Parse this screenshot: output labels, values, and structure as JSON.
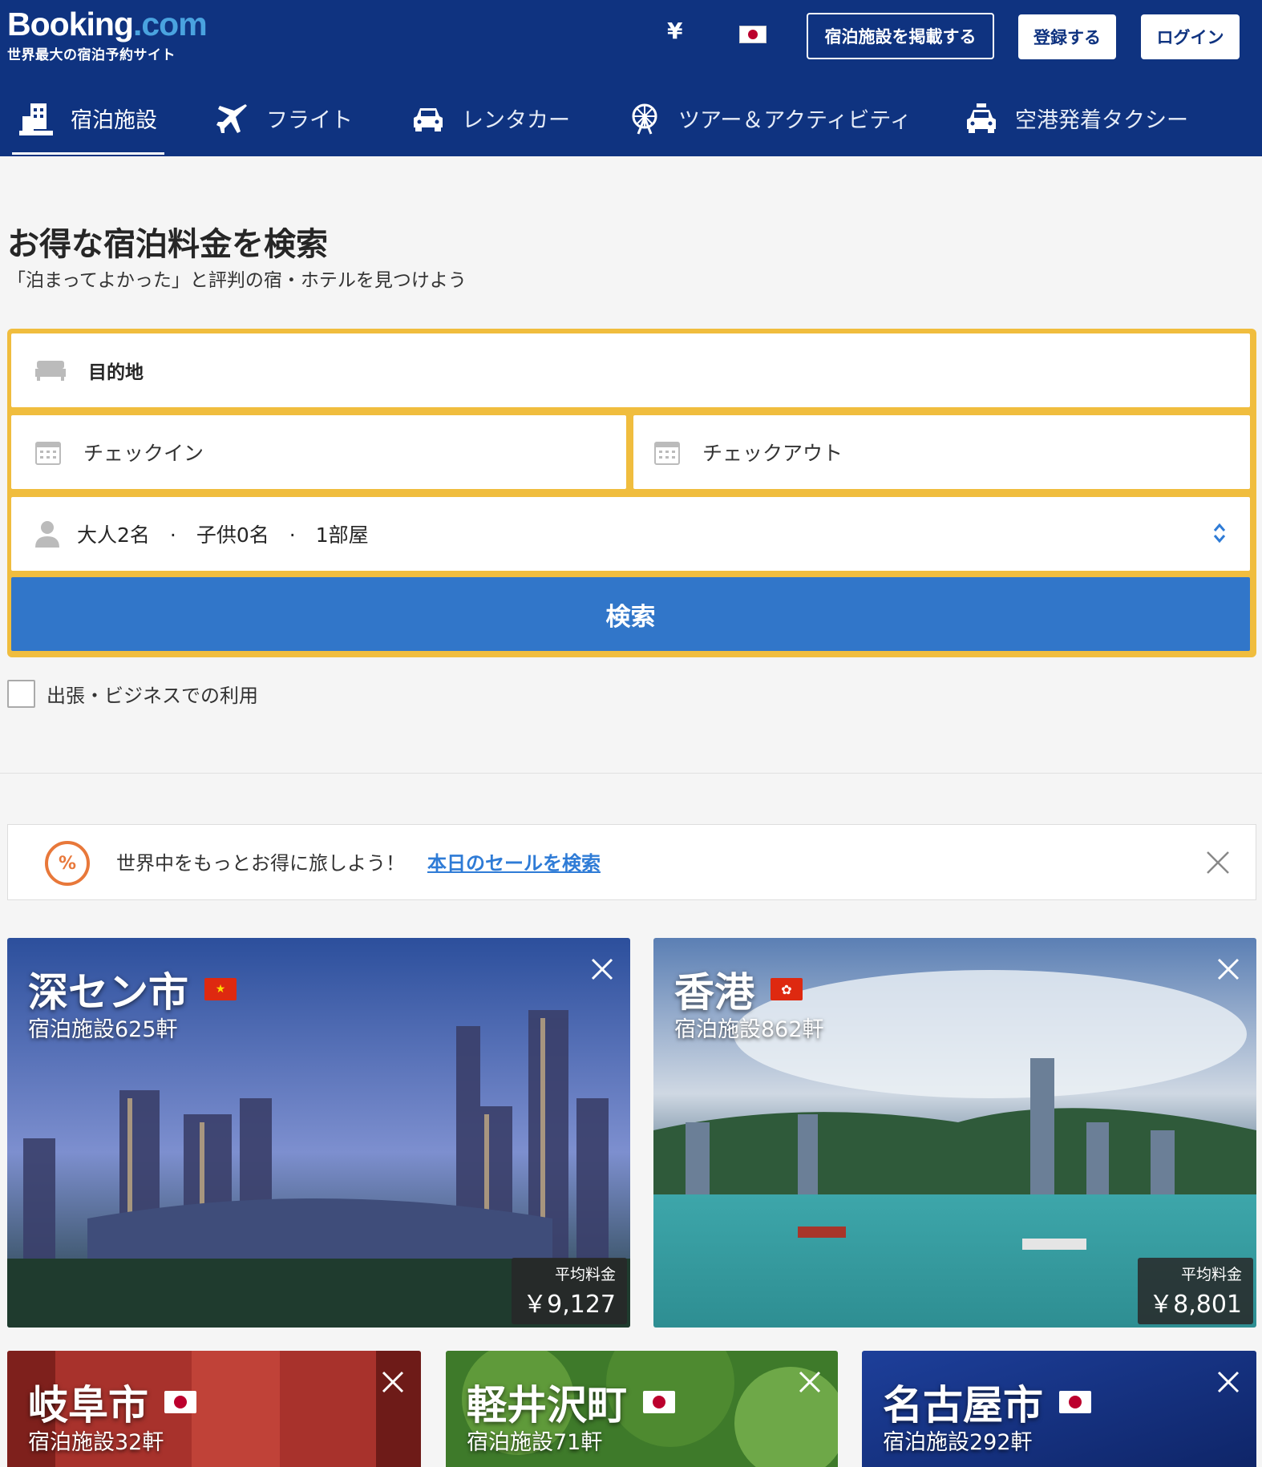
{
  "header": {
    "logo_main": "Booking",
    "logo_dotcom": ".com",
    "logo_tagline": "世界最大の宿泊予約サイト",
    "currency": "¥",
    "list_property": "宿泊施設を掲載する",
    "register": "登録する",
    "login": "ログイン"
  },
  "nav": {
    "items": [
      {
        "label": "宿泊施設",
        "icon": "bed-building-icon",
        "active": true
      },
      {
        "label": "フライト",
        "icon": "plane-icon"
      },
      {
        "label": "レンタカー",
        "icon": "car-icon"
      },
      {
        "label": "ツアー＆アクティビティ",
        "icon": "ferris-wheel-icon"
      },
      {
        "label": "空港発着タクシー",
        "icon": "taxi-icon"
      }
    ]
  },
  "hero": {
    "title": "お得な宿泊料金を検索",
    "subtitle": "「泊まってよかった」と評判の宿・ホテルを見つけよう"
  },
  "search": {
    "destination_placeholder": "目的地",
    "checkin": "チェックイン",
    "checkout": "チェックアウト",
    "guests": "大人2名　·　子供0名　·　1部屋",
    "button": "検索",
    "business_travel": "出張・ビジネスでの利用"
  },
  "promo": {
    "text": "世界中をもっとお得に旅しよう！",
    "link": "本日のセールを検索"
  },
  "destinations": [
    {
      "city": "深セン市",
      "count": "宿泊施設625軒",
      "price_label": "平均料金",
      "price": "￥9,127",
      "flag": "china"
    },
    {
      "city": "香港",
      "count": "宿泊施設862軒",
      "price_label": "平均料金",
      "price": "￥8,801",
      "flag": "hongkong"
    },
    {
      "city": "岐阜市",
      "count": "宿泊施設32軒",
      "flag": "japan"
    },
    {
      "city": "軽井沢町",
      "count": "宿泊施設71軒",
      "flag": "japan"
    },
    {
      "city": "名古屋市",
      "count": "宿泊施設292軒",
      "flag": "japan"
    }
  ],
  "colors": {
    "brand_blue": "#0f3380",
    "search_yellow": "#f0bd3e",
    "button_blue": "#3176c9",
    "link_blue": "#2e7bd6"
  }
}
